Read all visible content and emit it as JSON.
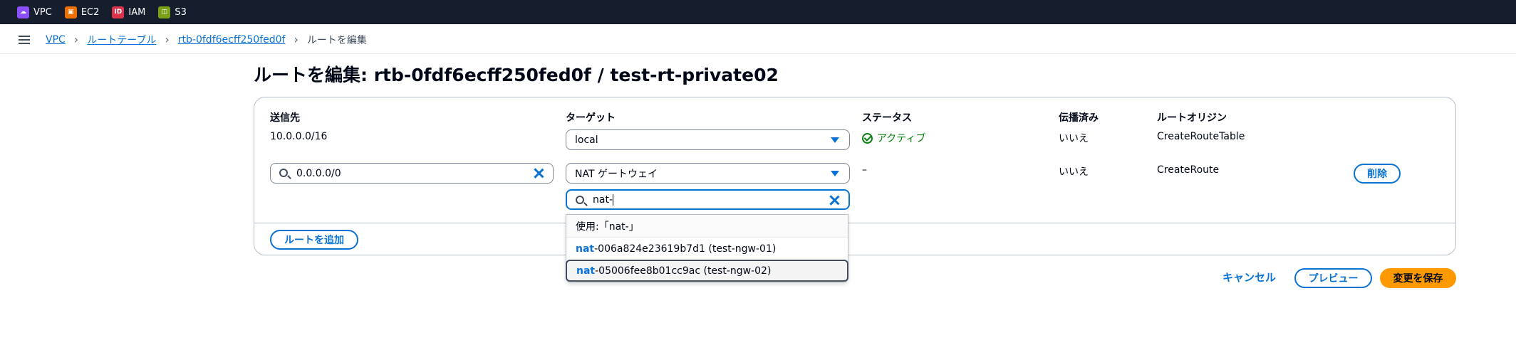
{
  "topbar": {
    "services": [
      {
        "label": "VPC",
        "color": "#8c4fff",
        "icon": "vpc-icon"
      },
      {
        "label": "EC2",
        "color": "#ed7100",
        "icon": "ec2-icon"
      },
      {
        "label": "IAM",
        "color": "#dd344c",
        "icon": "iam-icon"
      },
      {
        "label": "S3",
        "color": "#7aa116",
        "icon": "s3-icon"
      }
    ]
  },
  "breadcrumb": {
    "items": [
      "VPC",
      "ルートテーブル",
      "rtb-0fdf6ecff250fed0f"
    ],
    "current": "ルートを編集"
  },
  "page": {
    "title": "ルートを編集: rtb-0fdf6ecff250fed0f / test-rt-private02"
  },
  "table": {
    "headers": {
      "destination": "送信先",
      "target": "ターゲット",
      "status": "ステータス",
      "propagated": "伝播済み",
      "origin": "ルートオリジン"
    },
    "rows": [
      {
        "destination": "10.0.0.0/16",
        "target": "local",
        "status": "アクティブ",
        "propagated": "いいえ",
        "origin": "CreateRouteTable"
      },
      {
        "destination": "0.0.0.0/0",
        "target": "NAT ゲートウェイ",
        "target_search": "nat-",
        "status": "–",
        "propagated": "いいえ",
        "origin": "CreateRoute",
        "remove_label": "削除"
      }
    ],
    "add_route_label": "ルートを追加"
  },
  "dropdown": {
    "use_text": "使用:「nat-」",
    "options": [
      {
        "match": "nat",
        "rest": "-006a824e23619b7d1 (test-ngw-01)"
      },
      {
        "match": "nat",
        "rest": "-05006fee8b01cc9ac (test-ngw-02)"
      }
    ]
  },
  "footer": {
    "cancel": "キャンセル",
    "preview": "プレビュー",
    "save": "変更を保存"
  },
  "colors": {
    "link": "#0972d3",
    "primary": "#ff9900",
    "success": "#037f0c",
    "topbar": "#161e2d"
  }
}
